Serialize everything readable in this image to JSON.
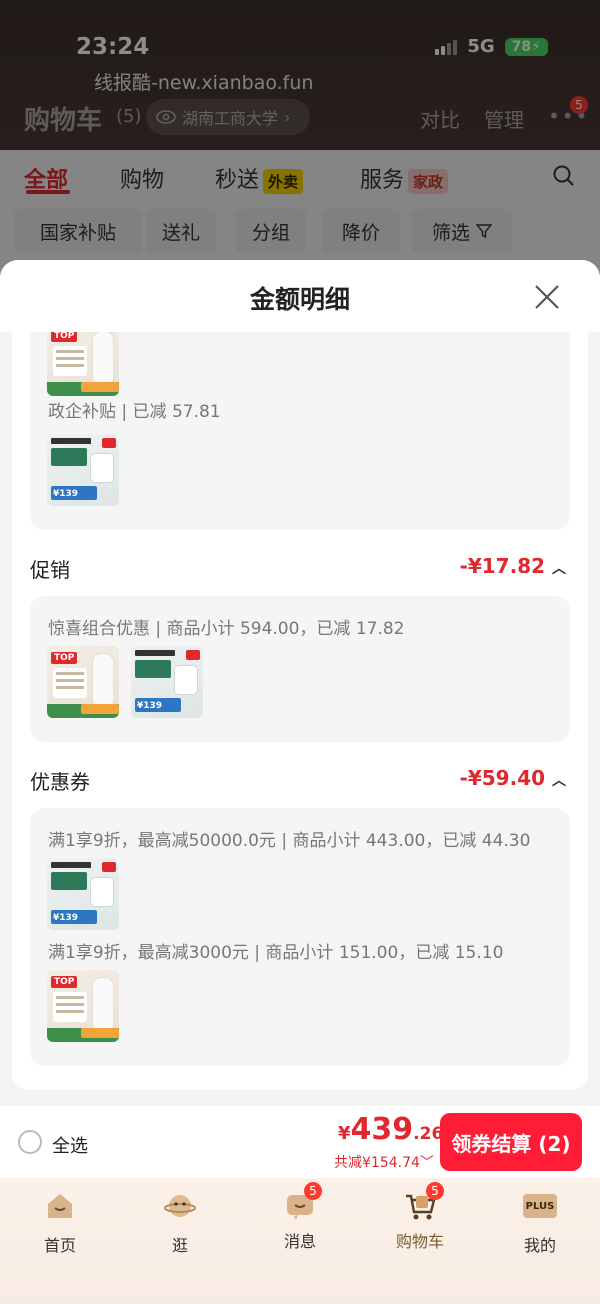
{
  "status_bar": {
    "time": "23:24",
    "network": "5G",
    "battery": "78"
  },
  "watermark": "线报酷-new.xianbao.fun",
  "header": {
    "title": "购物车",
    "count": "(5)",
    "location": "湖南工商大学",
    "compare": "对比",
    "manage": "管理",
    "more_badge": "5"
  },
  "tabs": [
    {
      "label": "全部",
      "active": true
    },
    {
      "label": "购物"
    },
    {
      "label": "秒送",
      "tag": "外卖"
    },
    {
      "label": "服务",
      "tag": "家政"
    }
  ],
  "filter_chips": [
    "国家补贴",
    "送礼",
    "分组",
    "降价",
    "筛选"
  ],
  "sheet": {
    "title": "金额明细",
    "subsidy": {
      "rule": "政企补贴 | 已减 57.81"
    },
    "promotion": {
      "title": "促销",
      "amount": "-¥17.82",
      "rule": "惊喜组合优惠 | 商品小计 594.00，已减 17.82"
    },
    "coupon": {
      "title": "优惠券",
      "amount": "-¥59.40",
      "rules": [
        "满1享9折，最高减50000.0元 | 商品小计 443.00，已减 44.30",
        "满1享9折，最高减3000元 | 商品小计 151.00，已减 15.10"
      ]
    },
    "thumb_text": {
      "top": "TOP",
      "price": "¥139"
    }
  },
  "checkout": {
    "select_all": "全选",
    "price_currency": "¥",
    "price_int": "439",
    "price_dec": ".26",
    "saved": "共减¥154.74",
    "button": "领券结算 (2)"
  },
  "tabbar": [
    {
      "label": "首页"
    },
    {
      "label": "逛"
    },
    {
      "label": "消息",
      "badge": "5"
    },
    {
      "label": "购物车",
      "badge": "5",
      "active": true
    },
    {
      "label": "我的",
      "icon_text": "PLUS"
    }
  ],
  "colors": {
    "accent_red": "#e0282e",
    "button_red": "#ff1c36",
    "battery_green": "#4cd964"
  }
}
